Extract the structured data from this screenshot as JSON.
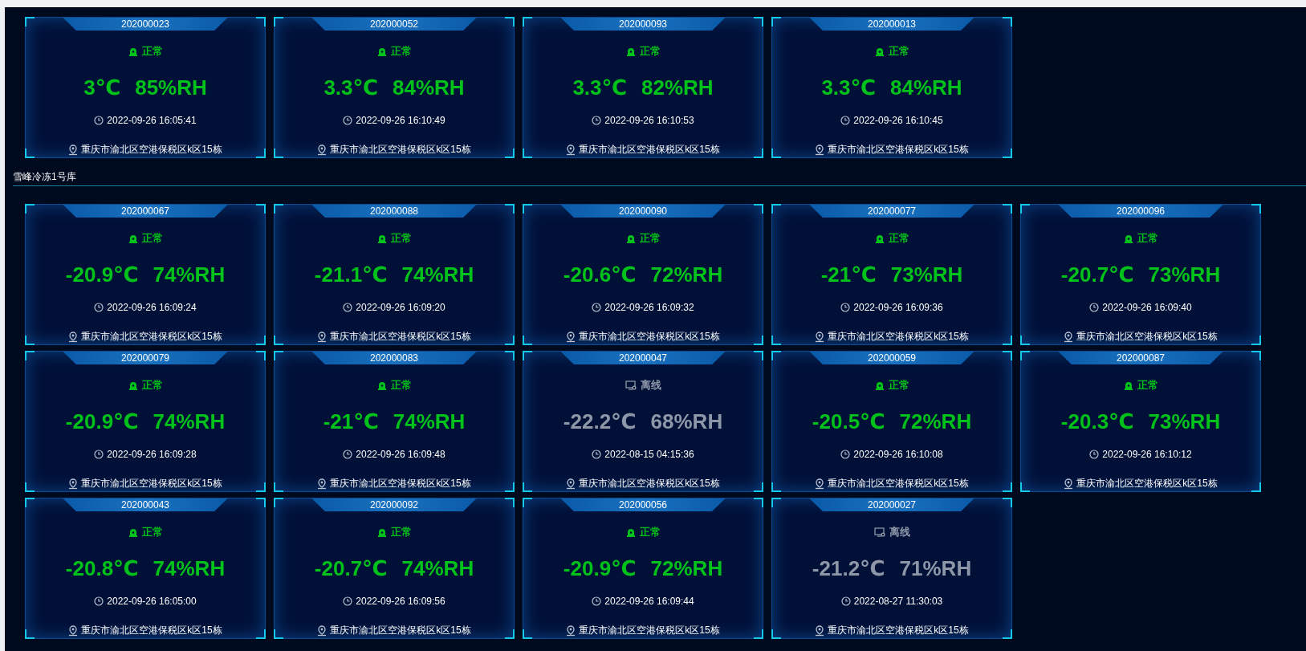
{
  "sections": [
    {
      "devices": [
        {
          "id": "202000023",
          "kind": "normal",
          "status_label": "正常",
          "temperature": "3℃",
          "humidity": "85%RH",
          "time": "2022-09-26 16:05:41",
          "address": "重庆市渝北区空港保税区k区15栋"
        },
        {
          "id": "202000052",
          "kind": "normal",
          "status_label": "正常",
          "temperature": "3.3℃",
          "humidity": "84%RH",
          "time": "2022-09-26 16:10:49",
          "address": "重庆市渝北区空港保税区k区15栋"
        },
        {
          "id": "202000093",
          "kind": "normal",
          "status_label": "正常",
          "temperature": "3.3℃",
          "humidity": "82%RH",
          "time": "2022-09-26 16:10:53",
          "address": "重庆市渝北区空港保税区k区15栋"
        },
        {
          "id": "202000013",
          "kind": "normal",
          "status_label": "正常",
          "temperature": "3.3℃",
          "humidity": "84%RH",
          "time": "2022-09-26 16:10:45",
          "address": "重庆市渝北区空港保税区k区15栋"
        }
      ]
    },
    {
      "title": "雪峰冷冻1号库",
      "devices": [
        {
          "id": "202000067",
          "kind": "normal",
          "status_label": "正常",
          "temperature": "-20.9℃",
          "humidity": "74%RH",
          "time": "2022-09-26 16:09:24",
          "address": "重庆市渝北区空港保税区k区15栋"
        },
        {
          "id": "202000088",
          "kind": "normal",
          "status_label": "正常",
          "temperature": "-21.1℃",
          "humidity": "74%RH",
          "time": "2022-09-26 16:09:20",
          "address": "重庆市渝北区空港保税区k区15栋"
        },
        {
          "id": "202000090",
          "kind": "normal",
          "status_label": "正常",
          "temperature": "-20.6℃",
          "humidity": "72%RH",
          "time": "2022-09-26 16:09:32",
          "address": "重庆市渝北区空港保税区k区15栋"
        },
        {
          "id": "202000077",
          "kind": "normal",
          "status_label": "正常",
          "temperature": "-21℃",
          "humidity": "73%RH",
          "time": "2022-09-26 16:09:36",
          "address": "重庆市渝北区空港保税区k区15栋"
        },
        {
          "id": "202000096",
          "kind": "normal",
          "status_label": "正常",
          "temperature": "-20.7℃",
          "humidity": "73%RH",
          "time": "2022-09-26 16:09:40",
          "address": "重庆市渝北区空港保税区k区15栋"
        },
        {
          "id": "202000079",
          "kind": "normal",
          "status_label": "正常",
          "temperature": "-20.9℃",
          "humidity": "74%RH",
          "time": "2022-09-26 16:09:28",
          "address": "重庆市渝北区空港保税区k区15栋"
        },
        {
          "id": "202000083",
          "kind": "normal",
          "status_label": "正常",
          "temperature": "-21℃",
          "humidity": "74%RH",
          "time": "2022-09-26 16:09:48",
          "address": "重庆市渝北区空港保税区k区15栋"
        },
        {
          "id": "202000047",
          "kind": "offline",
          "status_label": "离线",
          "temperature": "-22.2℃",
          "humidity": "68%RH",
          "time": "2022-08-15 04:15:36",
          "address": "重庆市渝北区空港保税区k区15栋"
        },
        {
          "id": "202000059",
          "kind": "normal",
          "status_label": "正常",
          "temperature": "-20.5℃",
          "humidity": "72%RH",
          "time": "2022-09-26 16:10:08",
          "address": "重庆市渝北区空港保税区k区15栋"
        },
        {
          "id": "202000087",
          "kind": "normal",
          "status_label": "正常",
          "temperature": "-20.3℃",
          "humidity": "73%RH",
          "time": "2022-09-26 16:10:12",
          "address": "重庆市渝北区空港保税区k区15栋"
        },
        {
          "id": "202000043",
          "kind": "normal",
          "status_label": "正常",
          "temperature": "-20.8℃",
          "humidity": "74%RH",
          "time": "2022-09-26 16:05:00",
          "address": "重庆市渝北区空港保税区k区15栋"
        },
        {
          "id": "202000092",
          "kind": "normal",
          "status_label": "正常",
          "temperature": "-20.7℃",
          "humidity": "74%RH",
          "time": "2022-09-26 16:09:56",
          "address": "重庆市渝北区空港保税区k区15栋"
        },
        {
          "id": "202000056",
          "kind": "normal",
          "status_label": "正常",
          "temperature": "-20.9℃",
          "humidity": "72%RH",
          "time": "2022-09-26 16:09:44",
          "address": "重庆市渝北区空港保税区k区15栋"
        },
        {
          "id": "202000027",
          "kind": "offline",
          "status_label": "离线",
          "temperature": "-21.2℃",
          "humidity": "71%RH",
          "time": "2022-08-27 11:30:03",
          "address": "重庆市渝北区空港保税区k区15栋"
        }
      ]
    }
  ]
}
